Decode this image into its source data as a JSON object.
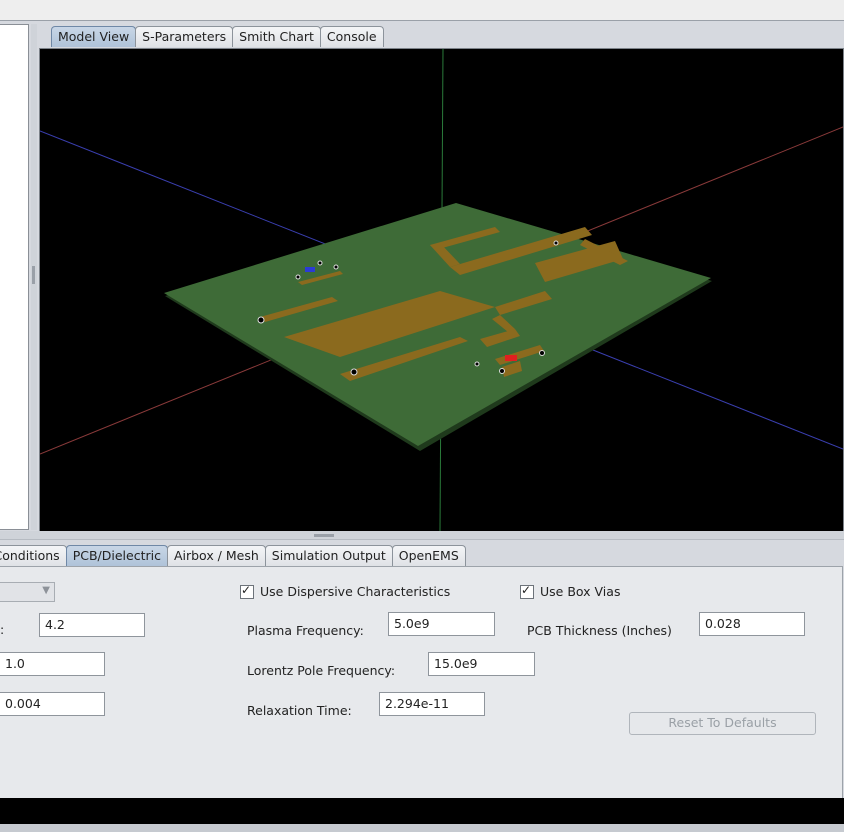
{
  "top_tabs": [
    "Model View",
    "S-Parameters",
    "Smith Chart",
    "Console"
  ],
  "bottom_tabs": [
    "ry Conditions",
    "PCB/Dielectric",
    "Airbox / Mesh",
    "Simulation Output",
    "OpenEMS"
  ],
  "left_fields": {
    "label_suffix": ":",
    "value1": "4.2",
    "value2": "1.0",
    "value3": "0.004"
  },
  "dispersive": {
    "checkbox_label": "Use Dispersive Characteristics",
    "plasma_label": "Plasma Frequency:",
    "plasma_value": "5.0e9",
    "lorentz_label": "Lorentz Pole Frequency:",
    "lorentz_value": "15.0e9",
    "relax_label": "Relaxation Time:",
    "relax_value": "2.294e-11"
  },
  "vias": {
    "checkbox_label": "Use Box Vias",
    "thickness_label": "PCB Thickness (Inches)",
    "thickness_value": "0.028"
  },
  "reset_label": "Reset To Defaults",
  "colors": {
    "board": "#3e6b37",
    "trace": "#8b6a1e",
    "background": "#000000"
  }
}
